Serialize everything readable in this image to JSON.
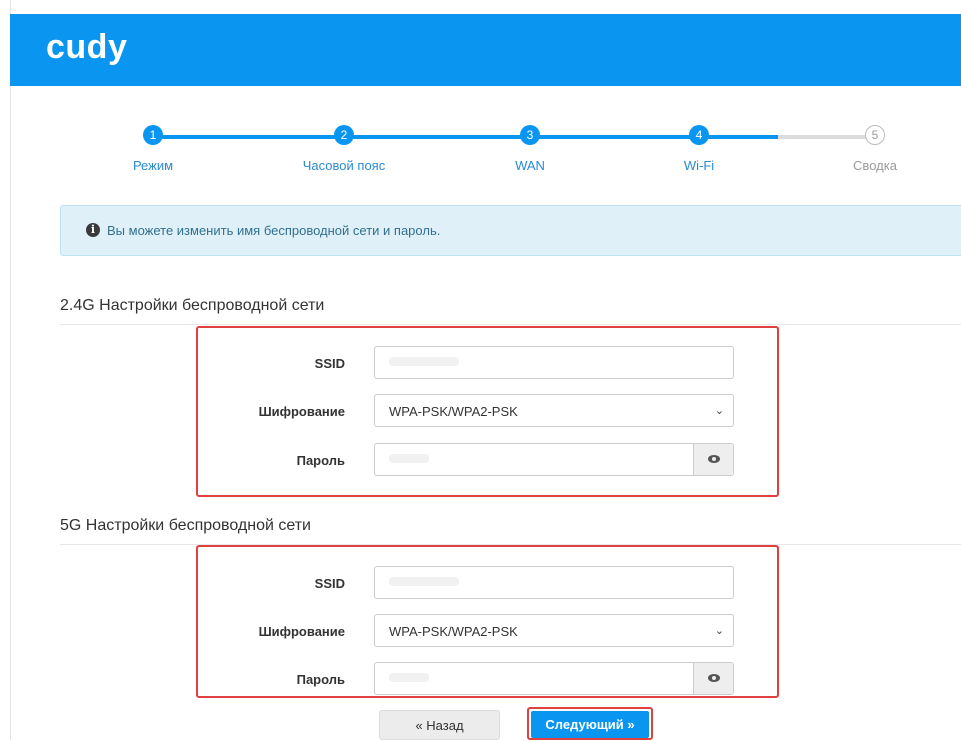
{
  "app": {
    "logo": "cudy"
  },
  "stepper": {
    "steps": [
      {
        "num": "1",
        "label": "Режим"
      },
      {
        "num": "2",
        "label": "Часовой пояс"
      },
      {
        "num": "3",
        "label": "WAN"
      },
      {
        "num": "4",
        "label": "Wi-Fi"
      },
      {
        "num": "5",
        "label": "Сводка"
      }
    ]
  },
  "alert": {
    "icon": "info-circle-icon",
    "text": "Вы можете изменить имя беспроводной сети и пароль."
  },
  "wifi24": {
    "title": "2.4G Настройки беспроводной сети",
    "ssid_label": "SSID",
    "enc_label": "Шифрование",
    "enc_value": "WPA-PSK/WPA2-PSK",
    "pwd_label": "Пароль"
  },
  "wifi5": {
    "title": "5G Настройки беспроводной сети",
    "ssid_label": "SSID",
    "enc_label": "Шифрование",
    "enc_value": "WPA-PSK/WPA2-PSK",
    "pwd_label": "Пароль"
  },
  "buttons": {
    "back": "« Назад",
    "next": "Следующий »"
  },
  "colors": {
    "brand": "#0a96f0",
    "highlight": "#e0403e",
    "alert_bg": "#dff0f8"
  }
}
